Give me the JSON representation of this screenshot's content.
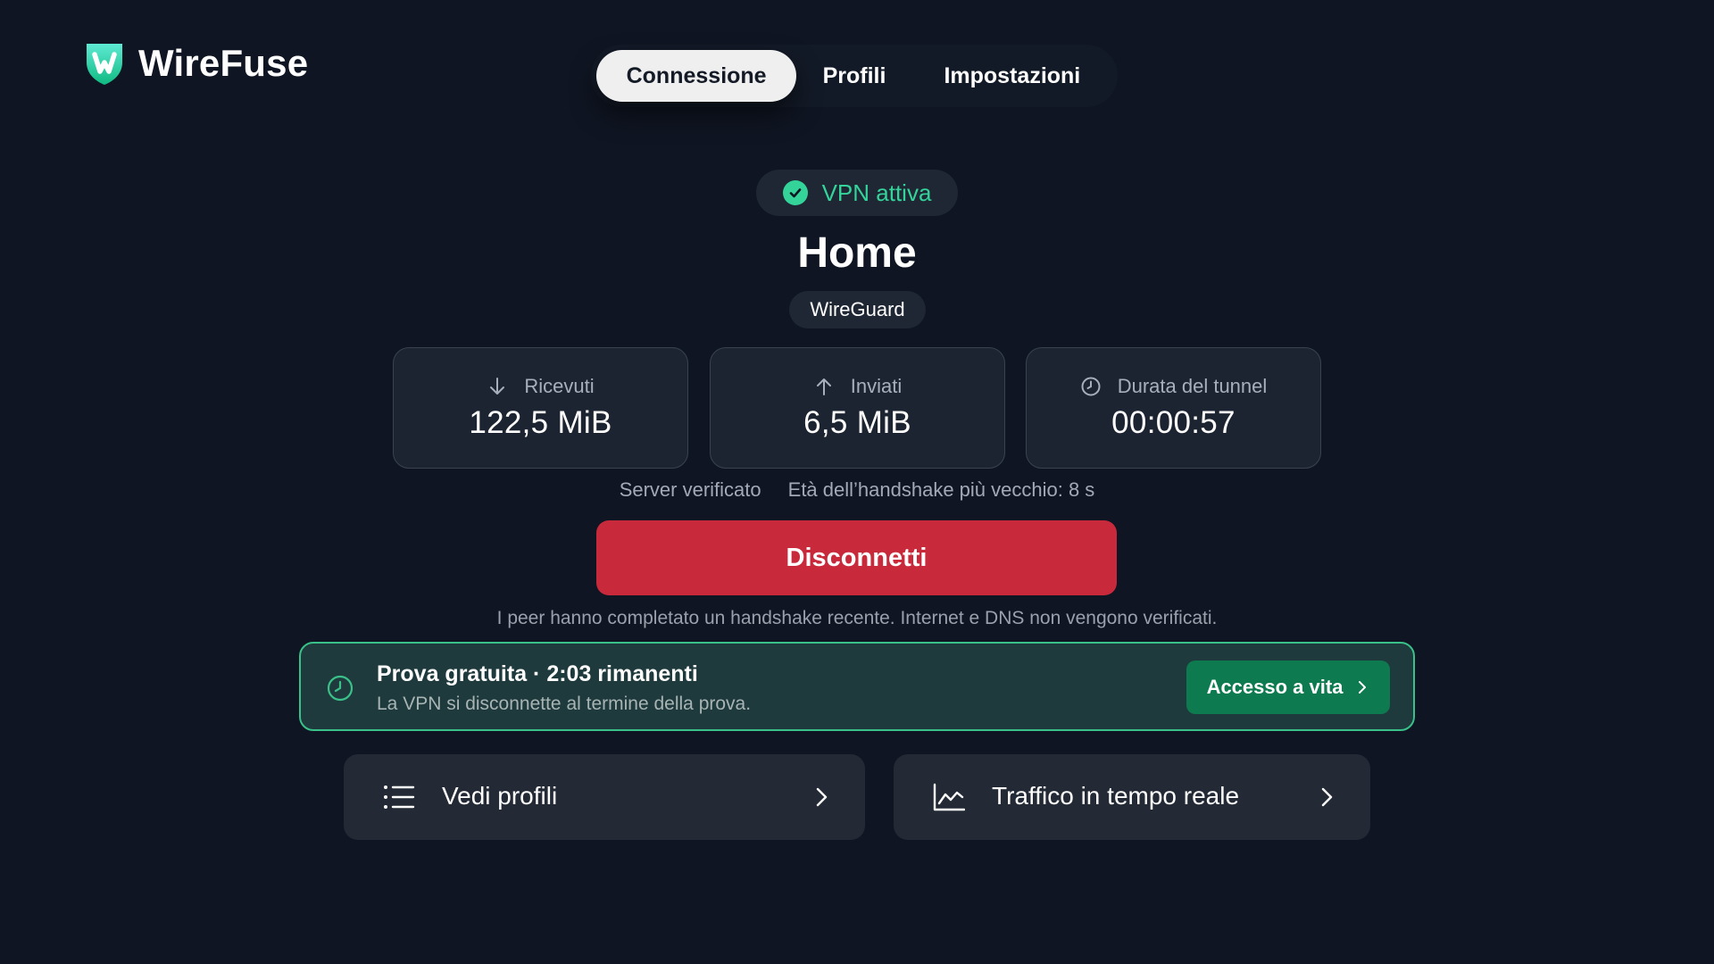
{
  "app": {
    "name": "WireFuse"
  },
  "tabs": [
    {
      "label": "Connessione",
      "active": true
    },
    {
      "label": "Profili",
      "active": false
    },
    {
      "label": "Impostazioni",
      "active": false
    }
  ],
  "status": {
    "label": "VPN attiva",
    "color": "#34d399"
  },
  "profile": {
    "name": "Home",
    "protocol": "WireGuard"
  },
  "stats": [
    {
      "icon": "arrow-down-icon",
      "label": "Ricevuti",
      "value": "122,5 MiB"
    },
    {
      "icon": "arrow-up-icon",
      "label": "Inviati",
      "value": "6,5 MiB"
    },
    {
      "icon": "clock-icon",
      "label": "Durata del tunnel",
      "value": "00:00:57"
    }
  ],
  "meta": {
    "server": "Server verificato",
    "handshake": "Età dell’handshake più vecchio: 8 s"
  },
  "actions": {
    "disconnect": "Disconnetti",
    "disconnect_color": "#c82a3c"
  },
  "note": "I peer hanno completato un handshake recente. Internet e DNS non vengono verificati.",
  "trial": {
    "title": "Prova gratuita · 2:03 rimanenti",
    "subtitle": "La VPN si disconnette al termine della prova.",
    "cta": "Accesso a vita",
    "accent": "#3ac089"
  },
  "links": [
    {
      "icon": "list-icon",
      "label": "Vedi profili"
    },
    {
      "icon": "chart-icon",
      "label": "Traffico in tempo reale"
    }
  ]
}
